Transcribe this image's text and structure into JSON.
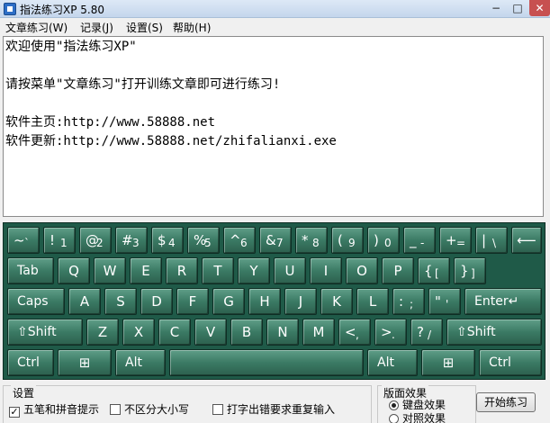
{
  "window": {
    "title": "指法练习XP 5.80",
    "min": "−",
    "max": "□",
    "close": "✕"
  },
  "menu": [
    "文章练习(W)",
    "记录(J)",
    "设置(S)",
    "帮助(H)"
  ],
  "text_lines": [
    "欢迎使用\"指法练习XP\"",
    "",
    "请按菜单\"文章练习\"打开训练文章即可进行练习!",
    "",
    "软件主页:http://www.58888.net",
    "软件更新:http://www.58888.net/zhifalianxi.exe"
  ],
  "keyboard": {
    "row1": [
      {
        "main": "~",
        "sub": "`"
      },
      {
        "main": "!",
        "sub": "1"
      },
      {
        "main": "@",
        "sub": "2"
      },
      {
        "main": "#",
        "sub": "3"
      },
      {
        "main": "$",
        "sub": "4"
      },
      {
        "main": "%",
        "sub": "5"
      },
      {
        "main": "^",
        "sub": "6"
      },
      {
        "main": "&",
        "sub": "7"
      },
      {
        "main": "*",
        "sub": "8"
      },
      {
        "main": "(",
        "sub": "9"
      },
      {
        "main": ")",
        "sub": "0"
      },
      {
        "main": "_",
        "sub": "-"
      },
      {
        "main": "+",
        "sub": "="
      },
      {
        "main": "|",
        "sub": "\\"
      }
    ],
    "backspace": "⟵",
    "tab": "Tab",
    "row2_letters": [
      "Q",
      "W",
      "E",
      "R",
      "T",
      "Y",
      "U",
      "I",
      "O",
      "P"
    ],
    "row2_sym": [
      {
        "main": "{",
        "sub": "["
      },
      {
        "main": "}",
        "sub": "]"
      }
    ],
    "caps": "Caps",
    "row3_letters": [
      "A",
      "S",
      "D",
      "F",
      "G",
      "H",
      "J",
      "K",
      "L"
    ],
    "row3_sym": [
      {
        "main": ":",
        "sub": ";"
      },
      {
        "main": "\"",
        "sub": "'"
      }
    ],
    "enter": "Enter↵",
    "shift_left": "⇧Shift",
    "row4_letters": [
      "Z",
      "X",
      "C",
      "V",
      "B",
      "N",
      "M"
    ],
    "row4_sym": [
      {
        "main": "<",
        "sub": ","
      },
      {
        "main": ">",
        "sub": "."
      },
      {
        "main": "?",
        "sub": "/"
      }
    ],
    "shift_right": "⇧Shift",
    "ctrl": "Ctrl",
    "alt": "Alt",
    "win": "⊞"
  },
  "settings": {
    "title": "设置",
    "opt1": "五笔和拼音提示",
    "opt1_checked": "✓",
    "opt2": "不区分大小写",
    "opt3": "打字出错要求重复输入"
  },
  "effect": {
    "title": "版面效果",
    "opt1": "键盘效果",
    "opt2": "对照效果"
  },
  "start_button": "开始练习"
}
